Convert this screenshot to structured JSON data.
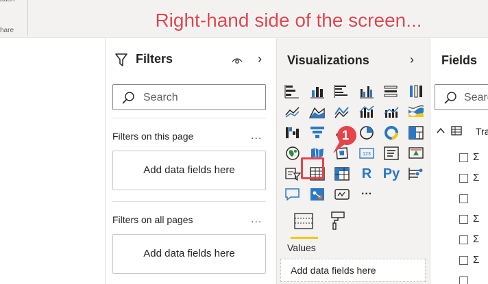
{
  "ribbon": {
    "partial_label_top": "ation",
    "partial_label": "hare"
  },
  "caption": "Right-hand side of the screen...",
  "filters": {
    "title": "Filters",
    "search_placeholder": "Search",
    "on_this_page": "Filters on this page",
    "on_all_pages": "Filters on all pages",
    "add_fields": "Add data fields here",
    "more": "..."
  },
  "visualizations": {
    "title": "Visualizations",
    "callout_number": "1",
    "r_visual": "R",
    "py_visual": "Py",
    "more": "···",
    "values_label": "Values",
    "add_fields": "Add data fields here"
  },
  "fields": {
    "title": "Fields",
    "search_placeholder": "Searc",
    "table_name": "Trar",
    "sigma": "Σ"
  },
  "colors": {
    "accent_red": "#e8424a",
    "power_bi_yellow": "#f2c811",
    "viz_blue": "#2b78c5"
  }
}
